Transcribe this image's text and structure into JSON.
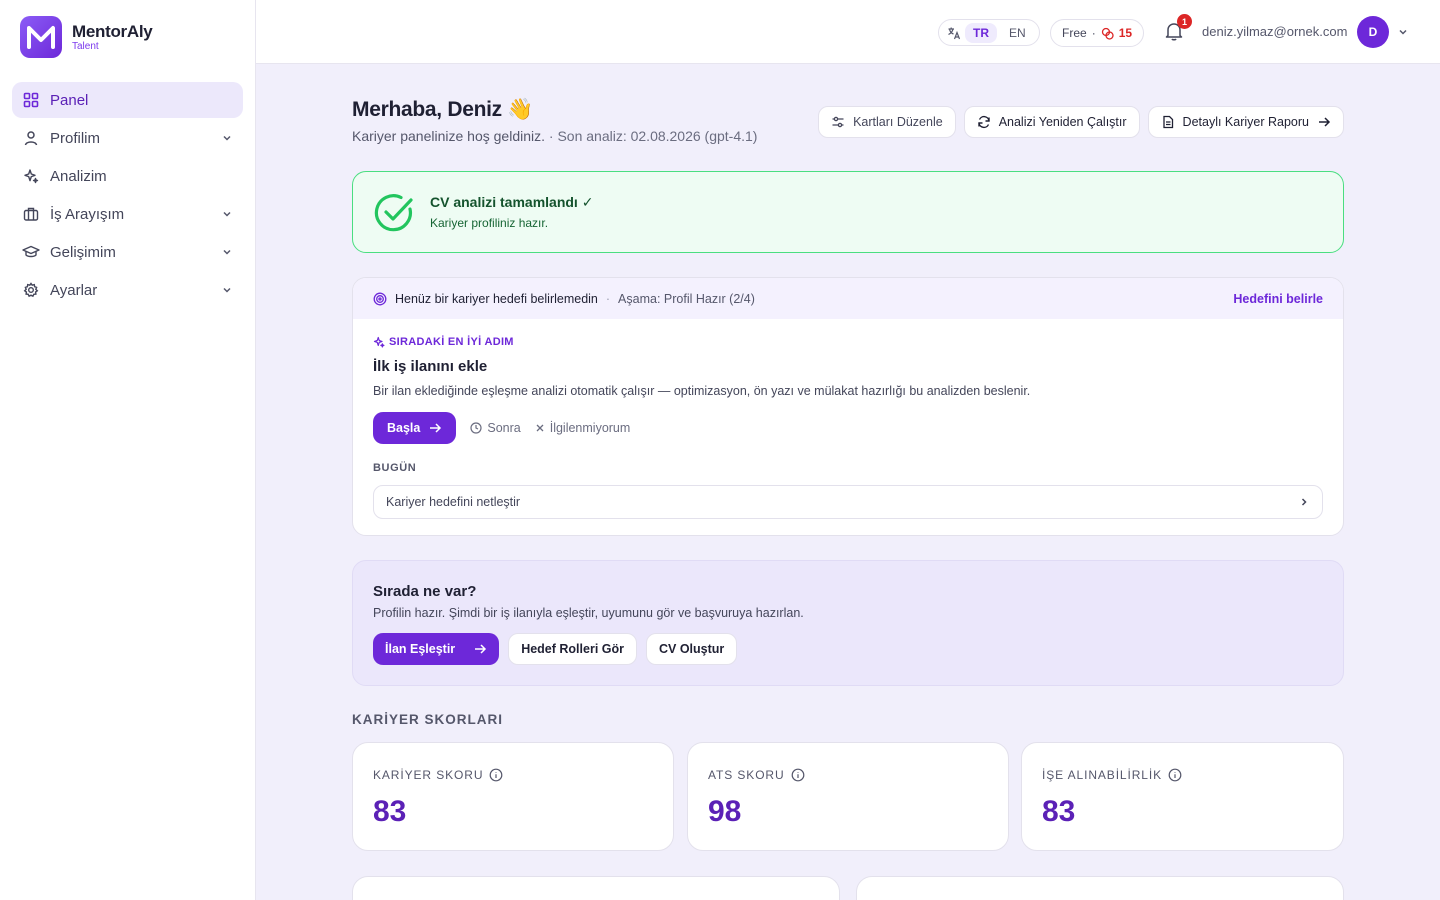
{
  "brand": {
    "name": "MentorAly",
    "sub": "Talent"
  },
  "sidebar": {
    "items": [
      {
        "label": "Panel",
        "icon": "grid-icon",
        "active": true
      },
      {
        "label": "Profilim",
        "icon": "user-icon",
        "expandable": true
      },
      {
        "label": "Analizim",
        "icon": "sparkles-icon"
      },
      {
        "label": "İş Arayışım",
        "icon": "briefcase-icon",
        "expandable": true
      },
      {
        "label": "Gelişimim",
        "icon": "graduation-cap-icon",
        "expandable": true
      },
      {
        "label": "Ayarlar",
        "icon": "gear-icon",
        "expandable": true
      }
    ]
  },
  "topbar": {
    "languages": [
      "TR",
      "EN"
    ],
    "active_language": "TR",
    "plan": "Free",
    "plan_separator": "·",
    "credits": "15",
    "notifications_count": "1",
    "user_email": "deniz.yilmaz@ornek.com",
    "avatar_initial": "D"
  },
  "header": {
    "greeting": "Merhaba, Deniz 👋",
    "welcome": "Kariyer panelinize hoş geldiniz.",
    "last_analysis": "· Son analiz: 02.08.2026 (gpt-4.1)",
    "buttons": {
      "edit_cards": "Kartları Düzenle",
      "rerun": "Analizi Yeniden Çalıştır",
      "report": "Detaylı Kariyer Raporu"
    }
  },
  "success": {
    "title": "CV analizi tamamlandı ✓",
    "subtitle": "Kariyer profiliniz hazır."
  },
  "goal": {
    "status": "Henüz bir kariyer hedefi belirlemedin",
    "separator": "·",
    "stage": "Aşama: Profil Hazır (2/4)",
    "link": "Hedefini belirle",
    "kicker": "SIRADAKİ EN İYİ ADIM",
    "title": "İlk iş ilanını ekle",
    "description": "Bir ilan eklediğinde eşleşme analizi otomatik çalışır — optimizasyon, ön yazı ve mülakat hazırlığı bu analizden beslenir.",
    "start": "Başla",
    "later": "Sonra",
    "dismiss": "İlgilenmiyorum",
    "today_label": "BUGÜN",
    "today_item": "Kariyer hedefini netleştir"
  },
  "whats_next": {
    "title": "Sırada ne var?",
    "description": "Profilin hazır. Şimdi bir iş ilanıyla eşleştir, uyumunu gör ve başvuruya hazırlan.",
    "primary": "İlan Eşleştir",
    "secondary": "Hedef Rolleri Gör",
    "tertiary": "CV Oluştur"
  },
  "scores": {
    "section_title": "KARİYER SKORLARI",
    "items": [
      {
        "label": "KARİYER SKORU",
        "value": "83"
      },
      {
        "label": "ATS SKORU",
        "value": "98"
      },
      {
        "label": "İŞE ALINABİLİRLİK",
        "value": "83"
      }
    ]
  },
  "colors": {
    "accent": "#6d28d9",
    "success": "#22c55e",
    "danger": "#dc2626"
  }
}
